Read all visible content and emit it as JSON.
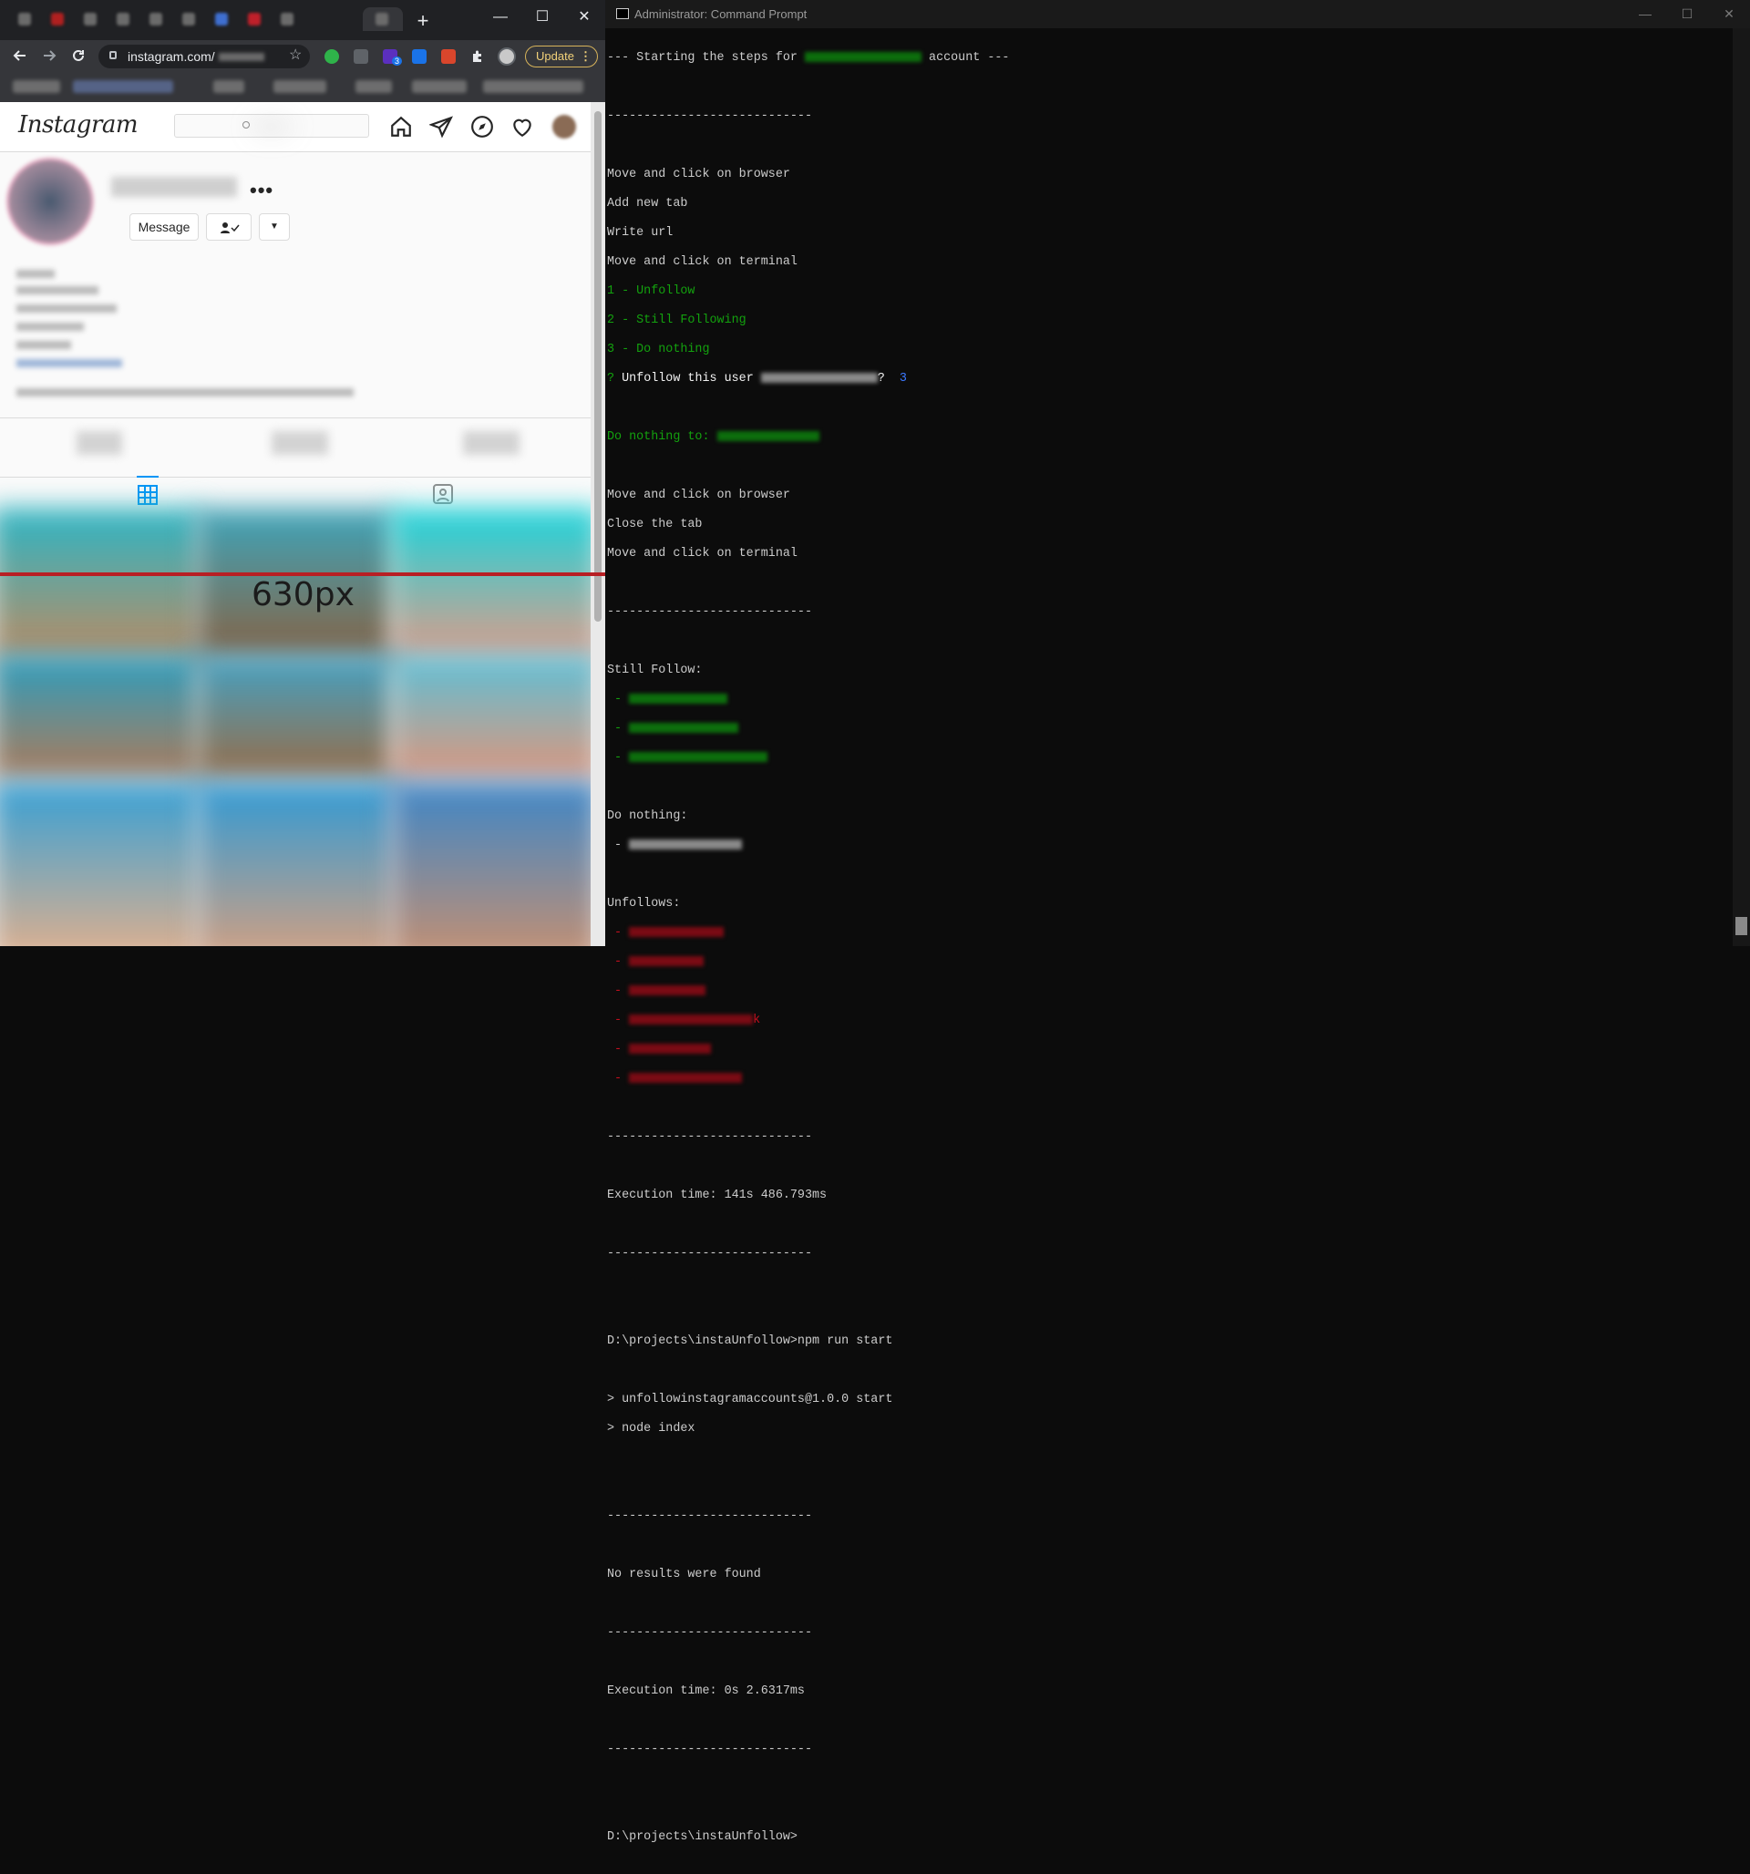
{
  "browser": {
    "url": "instagram.com/",
    "update_label": "Update",
    "new_tab": "+",
    "window_controls": {
      "minimize": "—",
      "maximize": "☐",
      "close": "✕"
    },
    "extension_badge": "3"
  },
  "instagram": {
    "logo": "Instagram",
    "search_placeholder": "Search",
    "message_label": "Message",
    "more_label": "•••",
    "dropdown_label": "▼"
  },
  "overlay": {
    "label": "630px",
    "line_color": "#b81f24"
  },
  "terminal": {
    "title": "Administrator: Command Prompt",
    "window_controls": {
      "minimize": "—",
      "maximize": "☐",
      "close": "✕"
    },
    "lines": {
      "l1_pre": "--- Starting the steps for",
      "l1_post": "account ---",
      "sep": "----------------------------",
      "move_browser": "Move and click on browser",
      "add_tab": "Add new tab",
      "write_url": "Write url",
      "move_terminal": "Move and click on terminal",
      "opt1": "1 - Unfollow",
      "opt2": "2 - Still Following",
      "opt3": "3 - Do nothing",
      "q_mark": "?",
      "q_text": "Unfollow this user",
      "q_end": "?",
      "q_answer": "3",
      "do_nothing_to": "Do nothing to:",
      "close_tab": "Close the tab",
      "still_follow": "Still Follow:",
      "bullet": " -",
      "do_nothing": "Do nothing:",
      "unfollows": "Unfollows:",
      "unfollow_tail": "k",
      "exec1": "Execution time: 141s 486.793ms",
      "cmd1": "D:\\projects\\instaUnfollow>npm run start",
      "npm1": "> unfollowinstagramaccounts@1.0.0 start",
      "npm2": "> node index",
      "no_results": "No results were found",
      "exec2": "Execution time: 0s 2.6317ms",
      "prompt": "D:\\projects\\instaUnfollow>"
    }
  },
  "colors": {
    "terminal_bg": "#0c0c0c",
    "terminal_text": "#cccccc",
    "terminal_green": "#13a10e",
    "terminal_red": "#c50f1f",
    "terminal_blue": "#3b78ff",
    "ig_story_ring": "#e4a8c1",
    "update_button": "#f3d27a"
  }
}
